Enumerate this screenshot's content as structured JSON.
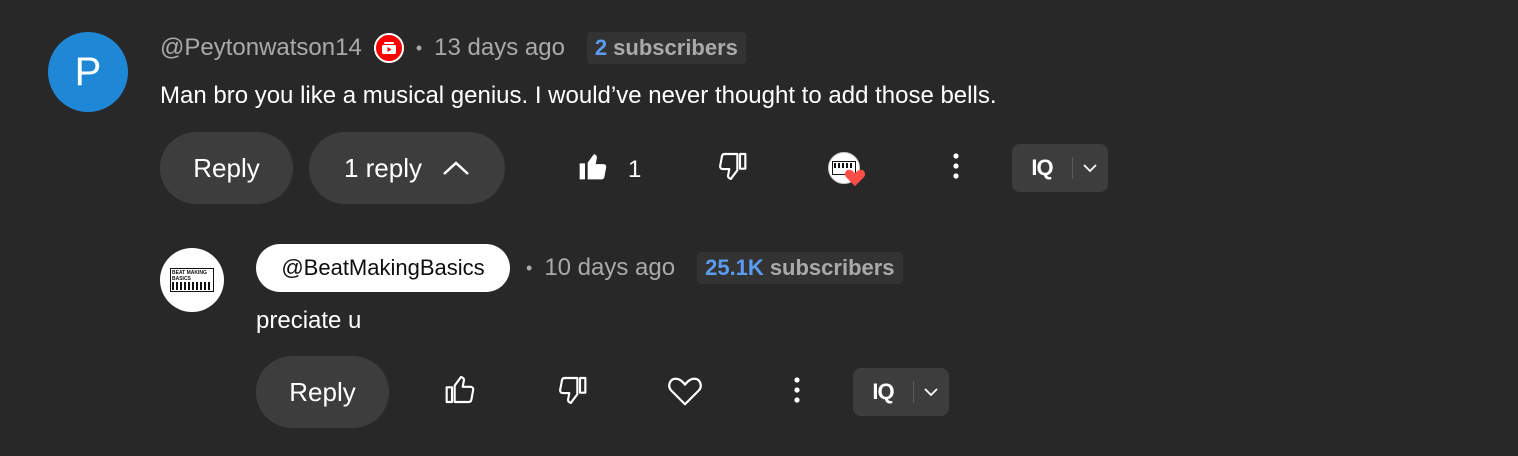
{
  "comment": {
    "avatar_letter": "P",
    "handle": "@Peytonwatson14",
    "badge_icon": "member-badge-icon",
    "separator": "•",
    "time": "13 days ago",
    "subscribers": {
      "count": "2",
      "label": "subscribers"
    },
    "text": "Man bro you like a musical genius. I would’ve never thought to add those bells.",
    "actions": {
      "reply_label": "Reply",
      "replies_label": "1 reply",
      "like_count": "1",
      "iq_label": "IQ"
    }
  },
  "reply": {
    "handle": "@BeatMakingBasics",
    "avatar_text": "BEAT MAKING BASICS",
    "separator": "•",
    "time": "10 days ago",
    "subscribers": {
      "count": "25.1K",
      "label": "subscribers"
    },
    "text": "preciate u",
    "actions": {
      "reply_label": "Reply",
      "iq_label": "IQ"
    }
  },
  "colors": {
    "background": "#282828",
    "avatar_blue": "#1e88d6",
    "subs_count_blue": "#5a9cf0",
    "heart_red": "#ff4e45",
    "pill_bg": "#3d3d3d"
  }
}
